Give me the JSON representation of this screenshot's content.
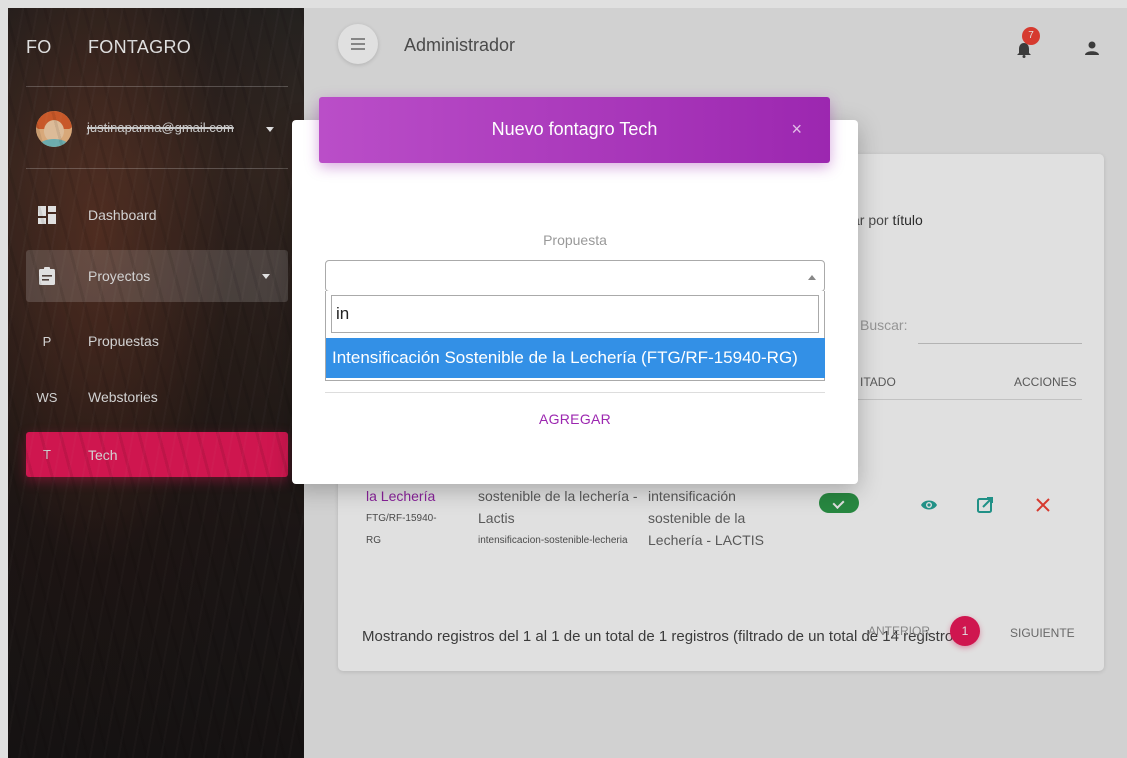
{
  "sidebar": {
    "brand_mini": "FO",
    "brand_full": "FONTAGRO",
    "user_email": "justinaparma@gmail.com",
    "items": [
      {
        "label": "Dashboard",
        "icon": "dashboard-icon"
      },
      {
        "label": "Proyectos",
        "icon": "clipboard-icon"
      },
      {
        "label": "Propuestas",
        "letter": "P"
      },
      {
        "label": "Webstories",
        "letter": "WS"
      },
      {
        "label": "Tech",
        "letter": "T"
      }
    ]
  },
  "topbar": {
    "title": "Administrador",
    "notification_count": "7"
  },
  "table": {
    "search_hint_prefix": "ar por ",
    "search_hint_bold": "título",
    "search_label": "Buscar:",
    "col_estado": "ITADO",
    "col_acciones": "ACCIONES",
    "row": {
      "title": "la Lechería",
      "code": "FTG/RF-15940-RG",
      "col2": "sostenible de la lechería - Lactis",
      "slug": "intensificacion-sostenible-lecheria",
      "col3": "intensificación sostenible de la Lechería - LACTIS"
    },
    "footer": "Mostrando registros del 1 al 1 de un total de 1 registros (filtrado de un total de 14 registros)",
    "pagination": {
      "prev": "ANTERIOR",
      "page": "1",
      "next": "SIGUIENTE"
    }
  },
  "modal": {
    "title": "Nuevo fontagro Tech",
    "close": "×",
    "field_label": "Propuesta",
    "search_value": "in",
    "option": "Intensificación Sostenible de la Lechería (FTG/RF-15940-RG)",
    "submit": "AGREGAR"
  },
  "colors": {
    "accent_pink": "#ec1a5a",
    "modal_purple": "#9c27b0",
    "option_blue": "#3390e6",
    "status_green": "#2e9b4a"
  }
}
